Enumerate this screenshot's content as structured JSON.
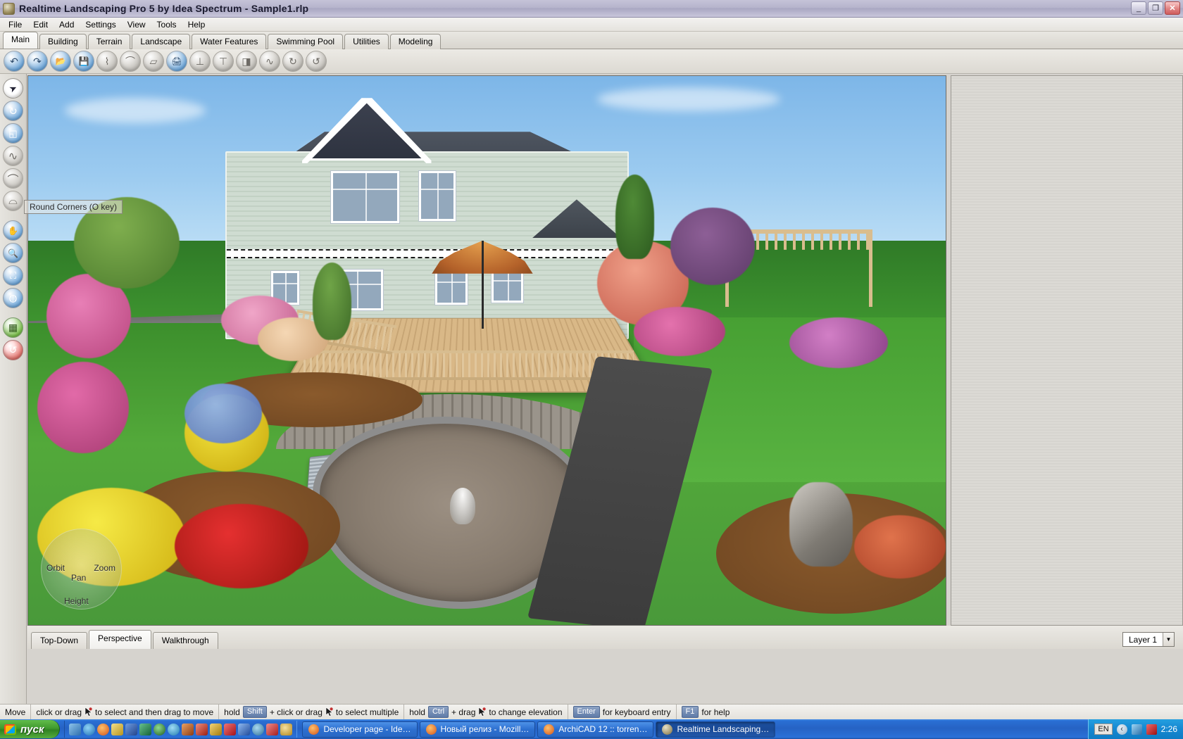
{
  "window": {
    "title": "Realtime Landscaping Pro 5 by Idea Spectrum - Sample1.rlp",
    "app_icon": "app-globe-icon",
    "minimize_label": "_",
    "maximize_label": "❐",
    "close_label": "✕"
  },
  "menu": {
    "items": [
      "File",
      "Edit",
      "Add",
      "Settings",
      "View",
      "Tools",
      "Help"
    ]
  },
  "ribbon_tabs": [
    {
      "label": "Main",
      "active": true
    },
    {
      "label": "Building",
      "active": false
    },
    {
      "label": "Terrain",
      "active": false
    },
    {
      "label": "Landscape",
      "active": false
    },
    {
      "label": "Water Features",
      "active": false
    },
    {
      "label": "Swimming Pool",
      "active": false
    },
    {
      "label": "Utilities",
      "active": false
    },
    {
      "label": "Modeling",
      "active": false
    }
  ],
  "toolbar": {
    "buttons": [
      {
        "name": "undo-icon",
        "glyph": "↶",
        "enabled": true
      },
      {
        "name": "redo-icon",
        "glyph": "↷",
        "enabled": true
      },
      {
        "name": "open-file-icon",
        "glyph": "📂",
        "enabled": true
      },
      {
        "name": "save-icon",
        "glyph": "💾",
        "enabled": true
      },
      {
        "name": "pick-tool-icon",
        "glyph": "⌇",
        "enabled": false
      },
      {
        "name": "curve-tool-icon",
        "glyph": "⌒",
        "enabled": false
      },
      {
        "name": "extrude-icon",
        "glyph": "▱",
        "enabled": false
      },
      {
        "name": "print-icon",
        "glyph": "🖨",
        "enabled": true
      },
      {
        "name": "align-ground-icon",
        "glyph": "⊥",
        "enabled": false
      },
      {
        "name": "flatten-icon",
        "glyph": "⊤",
        "enabled": false
      },
      {
        "name": "mirror-icon",
        "glyph": "◨",
        "enabled": false
      },
      {
        "name": "smooth-icon",
        "glyph": "∿",
        "enabled": false
      },
      {
        "name": "rotate-icon",
        "glyph": "↻",
        "enabled": false
      },
      {
        "name": "spin-icon",
        "glyph": "↺",
        "enabled": false
      }
    ]
  },
  "left_toolbar": {
    "buttons": [
      {
        "name": "select-arrow-icon",
        "glyph": "➤",
        "style": "white"
      },
      {
        "name": "rotate-object-icon",
        "glyph": "↻",
        "style": "blue"
      },
      {
        "name": "scale-object-icon",
        "glyph": "◱",
        "style": "blue"
      },
      {
        "name": "freehand-line-icon",
        "glyph": "∿",
        "style": "dim"
      },
      {
        "name": "arc-icon",
        "glyph": "⌒",
        "style": "dim"
      },
      {
        "name": "round-corners-icon",
        "glyph": "⌓",
        "style": "dim"
      },
      {
        "name": "pan-hand-icon",
        "glyph": "✋",
        "style": "blue"
      },
      {
        "name": "zoom-icon",
        "glyph": "🔍",
        "style": "blue"
      },
      {
        "name": "zoom-window-icon",
        "glyph": "⛶",
        "style": "blue"
      },
      {
        "name": "orbit-icon",
        "glyph": "◍",
        "style": "blue"
      },
      {
        "name": "terrain-grid-icon",
        "glyph": "▦",
        "style": "green"
      },
      {
        "name": "undo-view-icon",
        "glyph": "↺",
        "style": "red"
      }
    ]
  },
  "viewport": {
    "tooltip": "Round Corners (O key)",
    "nav_wheel": {
      "orbit": "Orbit",
      "zoom": "Zoom",
      "pan": "Pan",
      "height": "Height"
    }
  },
  "view_tabs": [
    {
      "label": "Top-Down",
      "active": false
    },
    {
      "label": "Perspective",
      "active": true
    },
    {
      "label": "Walkthrough",
      "active": false
    }
  ],
  "layer_selector": {
    "value": "Layer 1",
    "arrow": "▼"
  },
  "status_bar": {
    "mode": "Move",
    "segments": [
      {
        "before": "click or drag",
        "key": "",
        "cursor": true,
        "after": "to select and then drag to move"
      },
      {
        "before": "hold",
        "key": "Shift",
        "cursor": false,
        "after": ""
      },
      {
        "before": "+ click or drag",
        "key": "",
        "cursor": true,
        "after": "to select multiple"
      },
      {
        "before": "hold",
        "key": "Ctrl",
        "cursor": false,
        "after": ""
      },
      {
        "before": "+ drag",
        "key": "",
        "cursor": true,
        "after": "to change elevation"
      },
      {
        "before": "",
        "key": "Enter",
        "cursor": false,
        "after": "for keyboard entry"
      },
      {
        "before": "",
        "key": "F1",
        "cursor": false,
        "after": "for help"
      }
    ]
  },
  "taskbar": {
    "start_label": "пуск",
    "quick_launch": [
      {
        "name": "desktop-icon",
        "color": "#4a7fb5"
      },
      {
        "name": "internet-explorer-icon",
        "color": "#2b7ec4"
      },
      {
        "name": "firefox-icon",
        "color": "#e8701a"
      },
      {
        "name": "media-icon",
        "color": "#c9a227"
      },
      {
        "name": "word-icon",
        "color": "#2a5699"
      },
      {
        "name": "excel-icon",
        "color": "#1e7145"
      },
      {
        "name": "player-icon",
        "color": "#2c6f2c"
      },
      {
        "name": "k-lite-icon",
        "color": "#3a9fd0"
      },
      {
        "name": "archive-icon",
        "color": "#b4531f"
      },
      {
        "name": "winamp-icon",
        "color": "#c0392b"
      },
      {
        "name": "paint-icon",
        "color": "#d4a017"
      },
      {
        "name": "acrobat-icon",
        "color": "#cc2027"
      },
      {
        "name": "usb-icon",
        "color": "#3b7dd8"
      },
      {
        "name": "globe-icon",
        "color": "#4a90c2"
      },
      {
        "name": "abbyy-icon",
        "color": "#cf3b3b"
      },
      {
        "name": "clock-icon",
        "color": "#d6a93a"
      }
    ],
    "tasks": [
      {
        "label": "Developer page - Ide…",
        "icon": "firefox-icon",
        "active": false
      },
      {
        "label": "Новый релиз - Mozill…",
        "icon": "firefox-icon",
        "active": false
      },
      {
        "label": "ArchiCAD 12 :: torren…",
        "icon": "firefox-icon",
        "active": false
      },
      {
        "label": "Realtime Landscaping…",
        "icon": "app-globe-icon",
        "active": true
      }
    ],
    "tray": {
      "language": "EN",
      "icons": [
        {
          "name": "show-hidden-icons-icon",
          "glyph": "‹"
        },
        {
          "name": "network-icon",
          "glyph": "🖧"
        },
        {
          "name": "kaspersky-icon",
          "glyph": "K"
        }
      ],
      "clock": "2:26"
    }
  },
  "colors": {
    "title_bar": "#b6b4cc",
    "taskbar_blue": "#2663c4",
    "start_green": "#3f9a2e",
    "sky": "#9ccbf0",
    "lawn": "#53a93a",
    "house_siding": "#cfdcd1",
    "roof": "#434954",
    "deck_wood": "#d9b887"
  }
}
